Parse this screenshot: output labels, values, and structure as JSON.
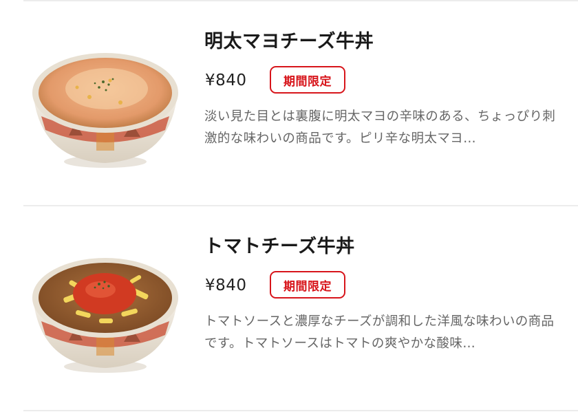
{
  "menu": {
    "items": [
      {
        "name": "明太マヨチーズ牛丼",
        "price": "¥840",
        "badge": "期間限定",
        "description": "淡い見た目とは裏腹に明太マヨの辛味のある、ちょっぴり刺激的な味わいの商品です。ピリ辛な明太マヨ…",
        "image": "bowl-mentaiko-mayo-cheese-gyudon"
      },
      {
        "name": "トマトチーズ牛丼",
        "price": "¥840",
        "badge": "期間限定",
        "description": "トマトソースと濃厚なチーズが調和した洋風な味わいの商品です。トマトソースはトマトの爽やかな酸味…",
        "image": "bowl-tomato-cheese-gyudon"
      }
    ]
  },
  "colors": {
    "badge_red": "#d7141a",
    "divider": "#ececec",
    "description_text": "#666666"
  }
}
